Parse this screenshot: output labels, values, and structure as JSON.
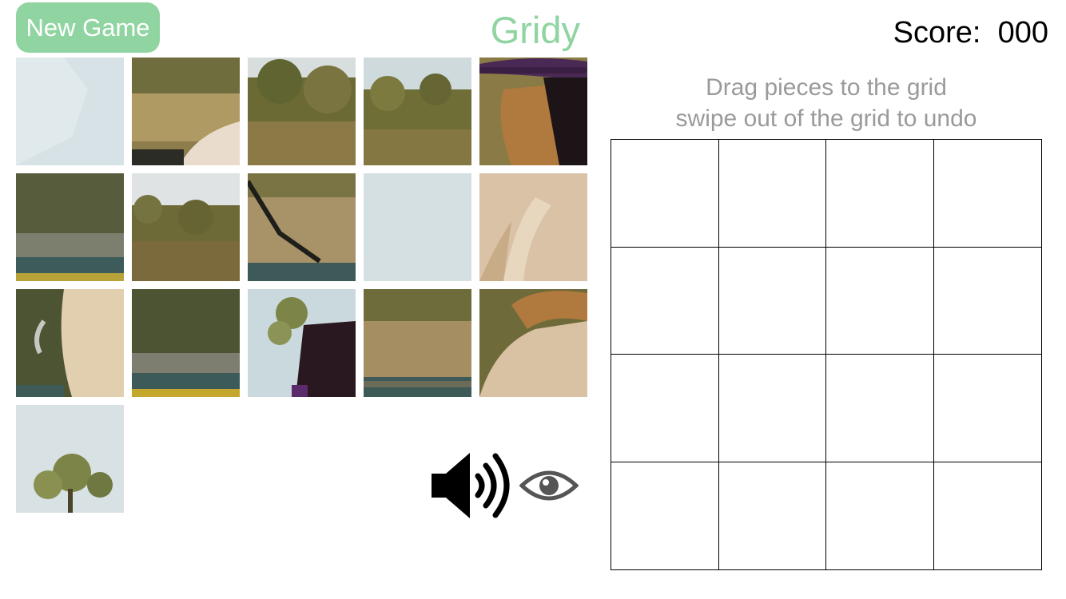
{
  "header": {
    "new_game_label": "New Game",
    "title": "Gridy",
    "score_label": "Score:",
    "score_value": "000"
  },
  "instructions": {
    "line1": "Drag pieces to the grid",
    "line2": "swipe out of the grid to undo"
  },
  "colors": {
    "accent": "#8fd4a1",
    "instruction_text": "#9a9a9a"
  },
  "tray": {
    "piece_count": 16
  },
  "grid": {
    "rows": 4,
    "columns": 4,
    "filled_cells": 0
  },
  "controls": {
    "sound_icon": "speaker-on-icon",
    "preview_icon": "eye-icon"
  }
}
